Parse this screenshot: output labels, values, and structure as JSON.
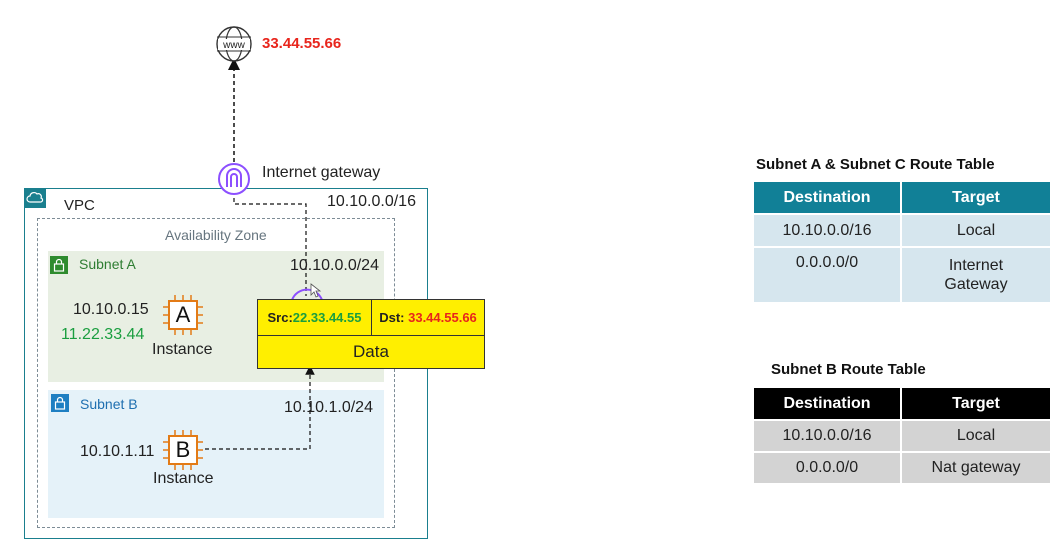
{
  "internet": {
    "ip": "33.44.55.66",
    "icon": "globe-www-icon"
  },
  "igw": {
    "label": "Internet gateway",
    "icon": "internet-gateway-icon"
  },
  "vpc": {
    "label": "VPC",
    "cidr": "10.10.0.0/16"
  },
  "az": {
    "label": "Availability Zone"
  },
  "subnet_a": {
    "label": "Subnet A",
    "cidr": "10.10.0.0/24"
  },
  "subnet_b": {
    "label": "Subnet B",
    "cidr": "10.10.1.0/24"
  },
  "instance_a": {
    "letter": "A",
    "label": "Instance",
    "private_ip": "10.10.0.15",
    "public_ip": "11.22.33.44"
  },
  "instance_b": {
    "letter": "B",
    "label": "Instance",
    "private_ip": "10.10.1.11"
  },
  "packet": {
    "src_label": "Src:",
    "src_ip": "22.33.44.55",
    "dst_label": "Dst:",
    "dst_ip": "33.44.55.66",
    "data_label": "Data"
  },
  "route_table_a": {
    "title": "Subnet A & Subnet C Route Table",
    "headers": [
      "Destination",
      "Target"
    ],
    "rows": [
      [
        "10.10.0.0/16",
        "Local"
      ],
      [
        "0.0.0.0/0",
        "Internet Gateway"
      ]
    ]
  },
  "route_table_b": {
    "title": "Subnet B Route Table",
    "headers": [
      "Destination",
      "Target"
    ],
    "rows": [
      [
        "10.10.0.0/16",
        "Local"
      ],
      [
        "0.0.0.0/0",
        "Nat gateway"
      ]
    ]
  },
  "colors": {
    "vpc_border": "#1a7f8e",
    "subnet_a_bg": "#e8efe3",
    "subnet_b_bg": "#e5f2f9",
    "instance_orange": "#e37b16",
    "ip_red": "#e8251c",
    "ip_green": "#1a9e3f",
    "packet_yellow": "#ffef00",
    "table_a_header": "#118097",
    "table_b_header": "#000000"
  }
}
